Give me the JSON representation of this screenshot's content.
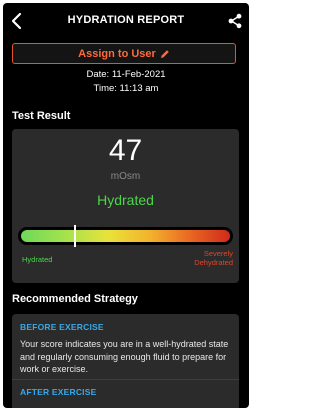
{
  "header": {
    "title": "HYDRATION REPORT",
    "back_icon": "chevron-left-icon",
    "share_icon": "share-icon"
  },
  "assign_button": {
    "label": "Assign to User",
    "icon": "pencil-icon",
    "color": "#ff6a3a"
  },
  "meta": {
    "date": "Date: 11-Feb-2021",
    "time": "Time: 11:13 am"
  },
  "test_result": {
    "section_title": "Test Result",
    "score": "47",
    "unit": "mOsm",
    "status": "Hydrated",
    "status_color": "#4cd64a",
    "gauge": {
      "level_fraction": 0.26,
      "left_label": "Hydrated",
      "right_label": "Severely Dehydrated"
    }
  },
  "strategy": {
    "section_title": "Recommended Strategy",
    "sections": [
      {
        "heading": "BEFORE EXERCISE",
        "body": "Your score indicates you are in a well-hydrated state and regularly consuming enough fluid to prepare for work or exercise."
      },
      {
        "heading": "AFTER EXERCISE"
      }
    ]
  }
}
